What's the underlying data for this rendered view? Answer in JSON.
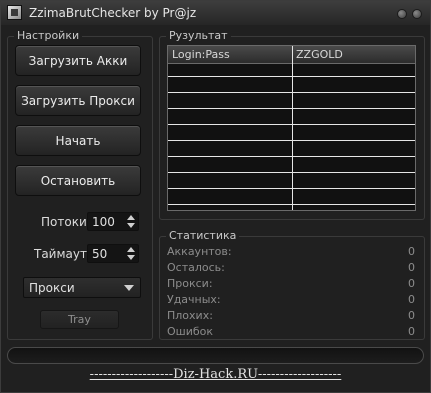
{
  "window": {
    "title": "ZzimaBrutChecker by Pr@jz"
  },
  "settings": {
    "group_label": "Настройки",
    "load_accounts_label": "Загрузить Акки",
    "load_proxy_label": "Загрузить Прокси",
    "start_label": "Начать",
    "stop_label": "Остановить",
    "threads_label": "Потоки:",
    "threads_value": "100",
    "timeout_label": "Таймаут:",
    "timeout_value": "50",
    "mode_selected": "Прокси",
    "tray_label": "Tray"
  },
  "results": {
    "group_label": "Рузультат",
    "columns": [
      "Login:Pass",
      "ZZGOLD"
    ]
  },
  "stats": {
    "group_label": "Статистика",
    "rows": [
      {
        "label": "Аккаунтов:",
        "value": "0"
      },
      {
        "label": "Осталось:",
        "value": "0"
      },
      {
        "label": "Прокси:",
        "value": "0"
      },
      {
        "label": "Удачных:",
        "value": "0"
      },
      {
        "label": "Плохих:",
        "value": "0"
      },
      {
        "label": "Ошибок",
        "value": "0"
      }
    ]
  },
  "footer": {
    "link_text": "-------------------Diz-Hack.RU-------------------"
  }
}
